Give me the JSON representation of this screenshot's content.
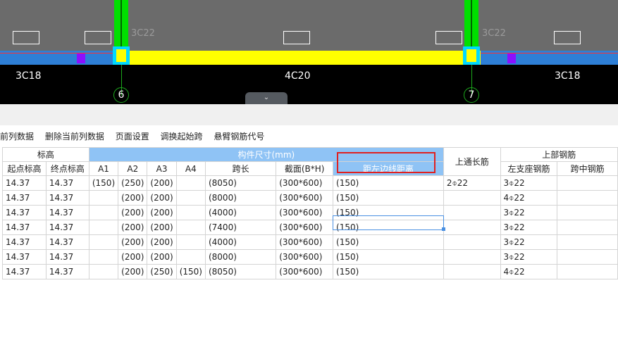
{
  "canvas": {
    "beam_left_label": "3C18",
    "beam_mid_label": "4C20",
    "beam_right_label": "3C18",
    "col_label_left": "3C22",
    "col_label_right": "3C22",
    "axis_6": "6",
    "axis_7": "7",
    "collapse_icon": "chevron-down-icon",
    "colors": {
      "background": "#6b6b6b",
      "beam_blue": "#2e7fd6",
      "beam_yellow": "#ffff00",
      "column_green": "#00e000",
      "column_cyan": "#00d8ff",
      "purple": "#8b10ff"
    }
  },
  "toolbar": {
    "items": [
      "前列数据",
      "删除当前列数据",
      "页面设置",
      "调换起始跨",
      "悬臂钢筋代号"
    ]
  },
  "table": {
    "group_headers": {
      "elevation": "标高",
      "dimensions": "构件尺寸(mm)",
      "top_through": "上通长筋",
      "top_rebar": "上部钢筋"
    },
    "col_headers": [
      "起点标高",
      "终点标高",
      "A1",
      "A2",
      "A3",
      "A4",
      "跨长",
      "截面(B*H)",
      "距左边线距离",
      "左支座钢筋",
      "跨中钢筋"
    ],
    "rows": [
      [
        "14.37",
        "14.37",
        "(150)",
        "(250)",
        "(200)",
        "",
        "(8050)",
        "(300*600)",
        "(150)",
        "2⌽22",
        "3⌽22",
        ""
      ],
      [
        "14.37",
        "14.37",
        "",
        "(200)",
        "(200)",
        "",
        "(8000)",
        "(300*600)",
        "(150)",
        "",
        "4⌽22",
        ""
      ],
      [
        "14.37",
        "14.37",
        "",
        "(200)",
        "(200)",
        "",
        "(4000)",
        "(300*600)",
        "(150)",
        "",
        "3⌽22",
        ""
      ],
      [
        "14.37",
        "14.37",
        "",
        "(200)",
        "(200)",
        "",
        "(7400)",
        "(300*600)",
        "(150)",
        "",
        "3⌽22",
        ""
      ],
      [
        "14.37",
        "14.37",
        "",
        "(200)",
        "(200)",
        "",
        "(4000)",
        "(300*600)",
        "(150)",
        "",
        "3⌽22",
        ""
      ],
      [
        "14.37",
        "14.37",
        "",
        "(200)",
        "(200)",
        "",
        "(8000)",
        "(300*600)",
        "(150)",
        "",
        "3⌽22",
        ""
      ],
      [
        "14.37",
        "14.37",
        "",
        "(200)",
        "(250)",
        "(150)",
        "(8050)",
        "(300*600)",
        "(150)",
        "",
        "4⌽22",
        ""
      ]
    ]
  }
}
